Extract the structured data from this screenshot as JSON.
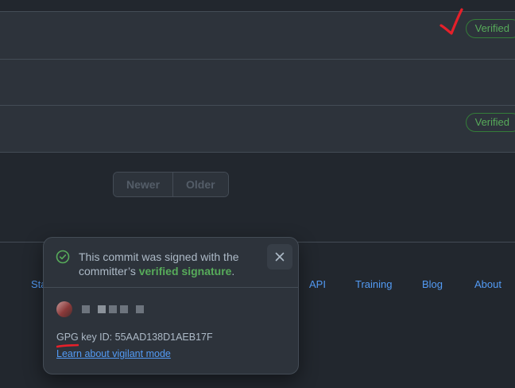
{
  "commits": [
    {
      "badge": "Verified"
    },
    {
      "badge": ""
    },
    {
      "badge": "Verified"
    }
  ],
  "pagination": {
    "newer": "Newer",
    "older": "Older"
  },
  "footer": {
    "links": [
      "Sta",
      "API",
      "Training",
      "Blog",
      "About"
    ]
  },
  "popover": {
    "message_prefix": "This commit was signed with the committer’s ",
    "message_highlight": "verified signature",
    "message_suffix": ".",
    "key_line": "GPG key ID: 55AAD138D1AEB17F",
    "learn_link": "Learn about vigilant mode"
  },
  "colors": {
    "background": "#22272e",
    "row_background": "#2d333b",
    "verified_green": "#57ab5a",
    "link_blue": "#539bf5",
    "annotation_red": "#e5202a"
  },
  "icons": {
    "popover_status": "check-circle-icon",
    "close": "close-icon"
  }
}
